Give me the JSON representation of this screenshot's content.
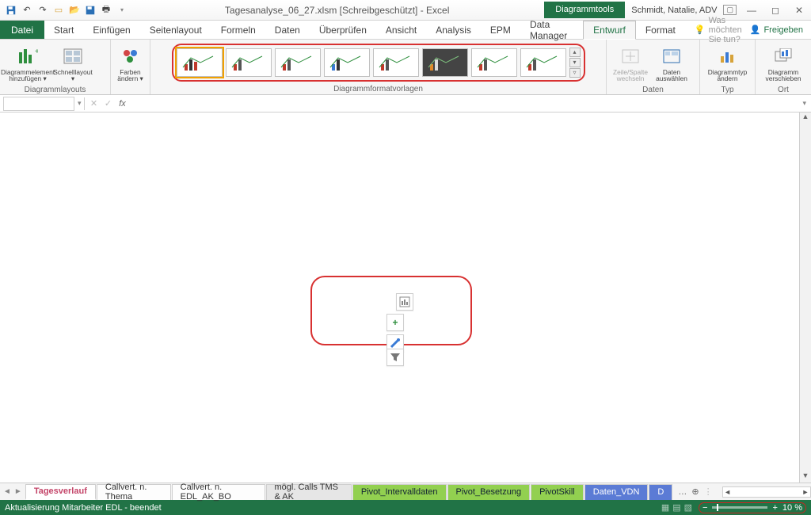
{
  "titlebar": {
    "title": "Tagesanalyse_06_27.xlsm  [Schreibgeschützt]  -  Excel",
    "contextual_tab": "Diagrammtools",
    "user": "Schmidt, Natalie, ADV"
  },
  "tabs": {
    "file": "Datei",
    "list": [
      "Start",
      "Einfügen",
      "Seitenlayout",
      "Formeln",
      "Daten",
      "Überprüfen",
      "Ansicht",
      "Analysis",
      "EPM",
      "Data Manager"
    ],
    "ctx": [
      "Entwurf",
      "Format"
    ],
    "active": "Entwurf",
    "tellme_placeholder": "Was möchten Sie tun?",
    "share": "Freigeben"
  },
  "ribbon": {
    "g_layouts": {
      "label": "Diagrammlayouts",
      "add_el": "Diagrammelement hinzufügen ▾",
      "quick": "Schnelllayout ▾"
    },
    "g_colors": {
      "btn": "Farben ändern ▾"
    },
    "g_styles": {
      "label": "Diagrammformatvorlagen"
    },
    "g_data": {
      "label": "Daten",
      "swap": "Zeile/Spalte wechseln",
      "select": "Daten auswählen"
    },
    "g_type": {
      "label": "Typ",
      "btn": "Diagrammtyp ändern"
    },
    "g_loc": {
      "label": "Ort",
      "btn": "Diagramm verschieben"
    }
  },
  "sheet_tabs": {
    "items": [
      {
        "name": "Tagesverlauf",
        "cls": "active"
      },
      {
        "name": "Callvert. n. Thema",
        "cls": ""
      },
      {
        "name": "Callvert. n. EDL_AK_BO",
        "cls": ""
      },
      {
        "name": "mögl. Calls TMS & AK",
        "cls": "greyp"
      },
      {
        "name": "Pivot_Intervalldaten",
        "cls": "green"
      },
      {
        "name": "Pivot_Besetzung",
        "cls": "green"
      },
      {
        "name": "PivotSkill",
        "cls": "green"
      },
      {
        "name": "Daten_VDN",
        "cls": "blue"
      },
      {
        "name": "D",
        "cls": "blue"
      }
    ]
  },
  "statusbar": {
    "msg": "Aktualisierung Mitarbeiter EDL - beendet",
    "zoom": "10 %"
  }
}
